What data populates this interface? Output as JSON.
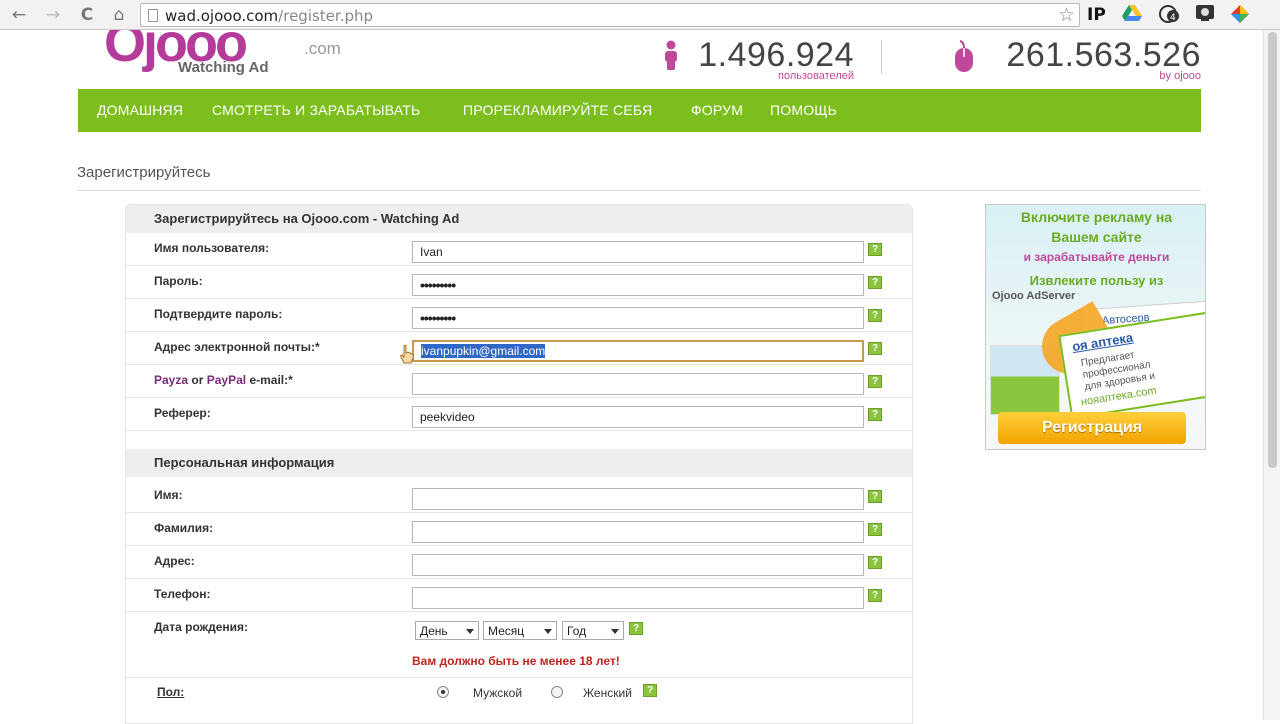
{
  "browser": {
    "url_host": "wad.ojooo.com",
    "url_path": "/register.php",
    "nav": [
      "←",
      "→",
      "C",
      "⌂"
    ],
    "extensions": [
      "IP"
    ]
  },
  "header": {
    "logo_brand": "Ojooo",
    "logo_dotcom": ".com",
    "logo_tag": "Watching Ad",
    "users_count": "1.496.924",
    "users_label": "пользователей",
    "ads_count": "261.563.526",
    "ads_label": "by ojooo",
    "colors": {
      "accent": "#b53b9a",
      "nav_green": "#7cbe1e"
    }
  },
  "nav": {
    "items": [
      "ДОМАШНЯЯ",
      "СМОТРЕТЬ И ЗАРАБАТЫВАТЬ",
      "ПРОРЕКЛАМИРУЙТЕ СЕБЯ",
      "ФОРУМ",
      "ПОМОЩЬ"
    ]
  },
  "page_title": "Зарегистрируйтесь",
  "form": {
    "account_title": "Зарегистрируйтесь на Ojooo.com - Watching Ad",
    "username_label": "Имя пользователя:",
    "username_value": "Ivan",
    "password_label": "Пароль:",
    "password_value": "•••••••••",
    "confirm_label": "Подтвердите пароль:",
    "confirm_value": "•••••••••",
    "email_label": "Адрес электронной почты:*",
    "email_value": "ivanpupkin@gmail.com",
    "payza_label": "Payza",
    "or_label": "or",
    "paypal_label": "PayPal",
    "pay_email_label": "e-mail:*",
    "pay_email_value": "",
    "referrer_label": "Реферер:",
    "referrer_value": "peekvideo",
    "personal_title": "Персональная информация",
    "first_name_label": "Имя:",
    "last_name_label": "Фамилия:",
    "address_label": "Адрес:",
    "phone_label": "Телефон:",
    "birth_label": "Дата рождения:",
    "day_label": "День",
    "month_label": "Месяц",
    "year_label": "Год",
    "age_warning": "Вам должно быть не менее 18 лет!",
    "gender_label": "Пол:",
    "male_label": "Мужской",
    "female_label": "Женский",
    "help_glyph": "?"
  },
  "ad": {
    "line1": "Включите рекламу на",
    "line2": "Вашем сайте",
    "line3": "и зарабатывайте деньги",
    "line4": "Извлеките пользу из",
    "line5": "Ojooo AdServer",
    "card1": "Автосерв",
    "card2_title": "оя аптека",
    "card2_text1": "Предлагает",
    "card2_text2": "профессионал",
    "card2_text3": "для здоровья и",
    "card2_site": "нояаптека.com",
    "button": "Регистрация"
  }
}
